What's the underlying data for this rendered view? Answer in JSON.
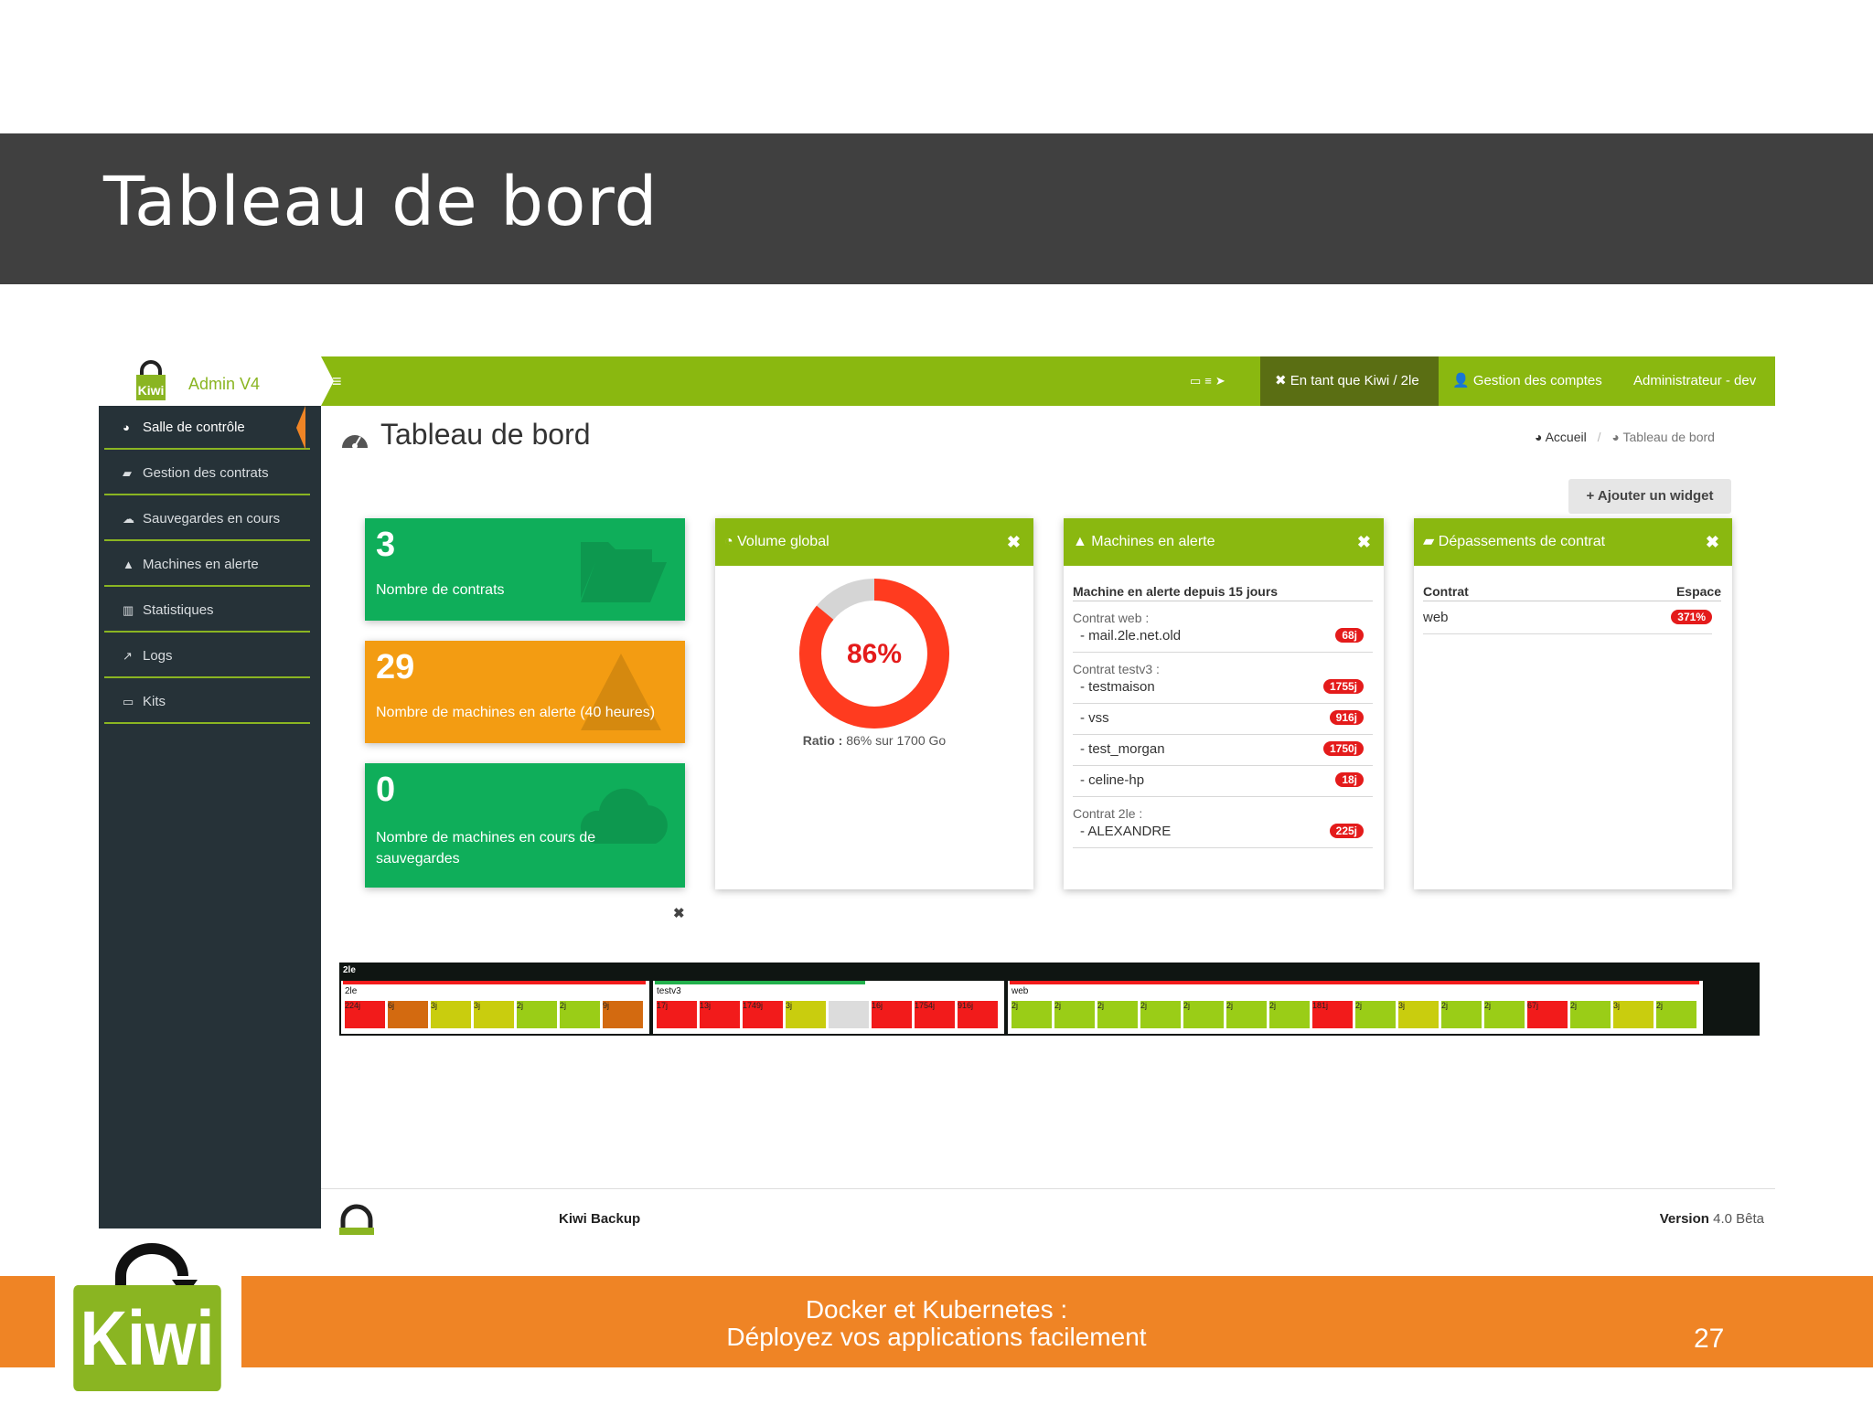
{
  "slide": {
    "title": "Tableau de bord",
    "footer_line1": "Docker et Kubernetes :",
    "footer_line2": "Déployez vos applications facilement",
    "page_number": "27",
    "logo_text": "Kiwi"
  },
  "app": {
    "brand": "Admin V4",
    "topbar": {
      "impersonate": "En tant que Kiwi / 2le",
      "accounts": "Gestion des comptes",
      "admin": "Administrateur - dev"
    },
    "sidebar": [
      {
        "label": "Salle de contrôle",
        "icon": "dashboard-icon"
      },
      {
        "label": "Gestion des contrats",
        "icon": "folder-open-icon"
      },
      {
        "label": "Sauvegardes en cours",
        "icon": "cloud-icon"
      },
      {
        "label": "Machines en alerte",
        "icon": "warning-icon"
      },
      {
        "label": "Statistiques",
        "icon": "bar-chart-icon"
      },
      {
        "label": "Logs",
        "icon": "line-chart-icon"
      },
      {
        "label": "Kits",
        "icon": "hdd-icon"
      }
    ],
    "page_title": "Tableau de bord",
    "breadcrumb": {
      "home": "Accueil",
      "current": "Tableau de bord"
    },
    "add_widget": "Ajouter un widget",
    "stats": [
      {
        "value": "3",
        "label": "Nombre de contrats",
        "color": "#0fae5a"
      },
      {
        "value": "29",
        "label": "Nombre de machines en alerte (40 heures)",
        "color": "#f39c12"
      },
      {
        "value": "0",
        "label": "Nombre de machines en cours de sauvegardes",
        "color": "#0fae5a"
      }
    ],
    "volume": {
      "title": "Volume global",
      "percent": "86%",
      "ratio_label": "Ratio :",
      "ratio_value": "86% sur 1700 Go"
    },
    "alerts": {
      "title": "Machines en alerte",
      "subtitle": "Machine en alerte depuis 15 jours",
      "contract_web": "Contrat web :",
      "contract_testv3": "Contrat testv3 :",
      "contract_2le": "Contrat 2le :",
      "rows": [
        {
          "name": "- mail.2le.net.old",
          "badge": "68j"
        },
        {
          "name": "- testmaison",
          "badge": "1755j"
        },
        {
          "name": "- vss",
          "badge": "916j"
        },
        {
          "name": "- test_morgan",
          "badge": "1750j"
        },
        {
          "name": "- celine-hp",
          "badge": "18j"
        },
        {
          "name": "- ALEXANDRE",
          "badge": "225j"
        }
      ]
    },
    "overruns": {
      "title": "Dépassements de contrat",
      "col_contract": "Contrat",
      "col_space": "Espace",
      "rows": [
        {
          "contract": "web",
          "space": "371%"
        }
      ]
    },
    "timeline": {
      "header": "2le",
      "groups": [
        {
          "name": "2le",
          "cells": [
            "224j",
            "6j",
            "3j",
            "3j",
            "2j",
            "2j",
            "9j"
          ]
        },
        {
          "name": "testv3",
          "cells": [
            "17j",
            "13j",
            "1749j",
            "3j",
            "",
            "16j",
            "1754j",
            "916j"
          ]
        },
        {
          "name": "web",
          "cells": [
            "2j",
            "2j",
            "2j",
            "2j",
            "2j",
            "2j",
            "2j",
            "181j",
            "2j",
            "3j",
            "2j",
            "2j",
            "67j",
            "2j",
            "3j",
            "2j"
          ]
        }
      ]
    },
    "footer": {
      "name": "Kiwi Backup",
      "version_label": "Version",
      "version": "4.0 Bêta"
    }
  },
  "colors": {
    "green": "#8ab810",
    "dark": "#263238",
    "orange": "#ef8425",
    "red": "#e41b1b"
  }
}
